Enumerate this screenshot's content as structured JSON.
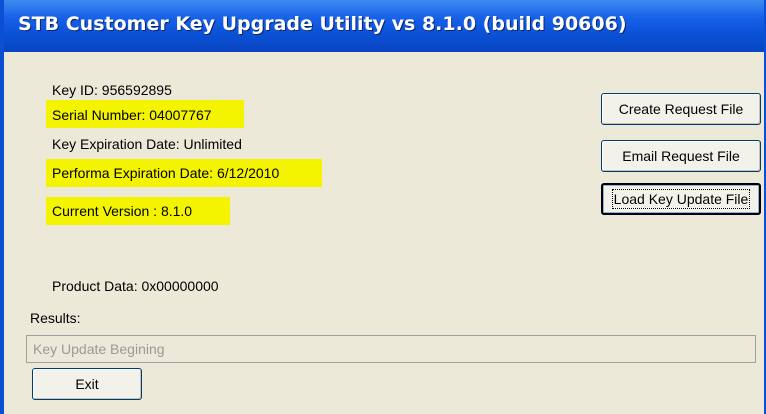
{
  "window": {
    "title": "STB Customer Key Upgrade Utility vs 8.1.0 (build 90606)"
  },
  "info": {
    "key_id": "Key ID:  956592895",
    "serial_number": "Serial Number: 04007767",
    "key_expiration": "Key Expiration Date: Unlimited",
    "performa_expiration": "Performa Expiration Date:  6/12/2010",
    "current_version": "Current Version :  8.1.0",
    "product_data": "Product Data: 0x00000000"
  },
  "highlight_color": "#f4f400",
  "buttons": {
    "create_request": "Create Request File",
    "email_request": "Email Request File",
    "load_key_update": "Load Key Update File",
    "exit": "Exit"
  },
  "results": {
    "label": "Results:",
    "value": "Key Update Begining"
  }
}
